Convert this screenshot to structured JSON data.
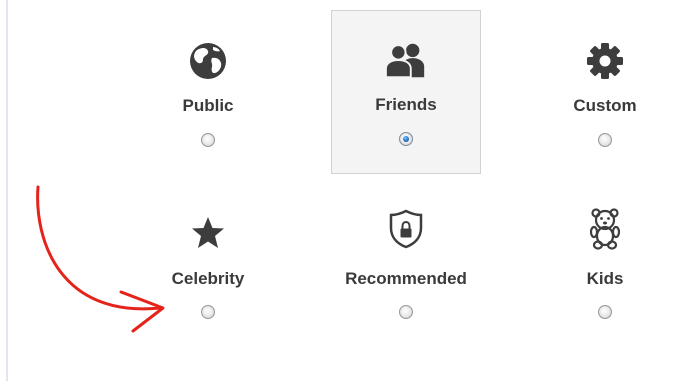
{
  "audience_options": [
    {
      "label": "Public",
      "icon": "globe-icon",
      "selected": false
    },
    {
      "label": "Friends",
      "icon": "friends-icon",
      "selected": true
    },
    {
      "label": "Custom",
      "icon": "gear-icon",
      "selected": false
    },
    {
      "label": "Celebrity",
      "icon": "star-icon",
      "selected": false
    },
    {
      "label": "Recommended",
      "icon": "shield-lock-icon",
      "selected": false
    },
    {
      "label": "Kids",
      "icon": "teddy-bear-icon",
      "selected": false
    }
  ],
  "annotation": {
    "type": "arrow",
    "color": "#e5231b",
    "points_to": "Celebrity"
  },
  "colors": {
    "label": "#3a3a3a",
    "icon": "#3d3d3d",
    "selected_background": "#f4f4f4",
    "selected_border": "#d2d2d2",
    "radio_checked": "#1e6fc2"
  }
}
